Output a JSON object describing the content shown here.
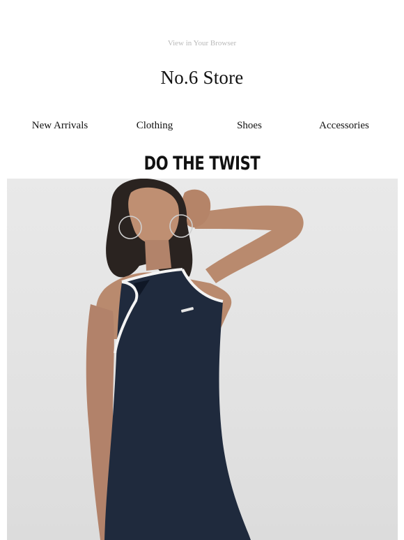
{
  "header": {
    "view_in_browser": "View in Your Browser",
    "store_name": "No.6 Store"
  },
  "nav": {
    "items": [
      {
        "label": "New Arrivals"
      },
      {
        "label": "Clothing"
      },
      {
        "label": "Shoes"
      },
      {
        "label": "Accessories"
      }
    ]
  },
  "hero": {
    "headline": "DO THE TWIST"
  },
  "colors": {
    "background": "#ffffff",
    "text": "#111111",
    "muted_link": "#b9b9b9",
    "photo_backdrop": "#e4e4e4",
    "dress_navy": "#1f2a3d",
    "dress_trim": "#f4f4f4"
  }
}
